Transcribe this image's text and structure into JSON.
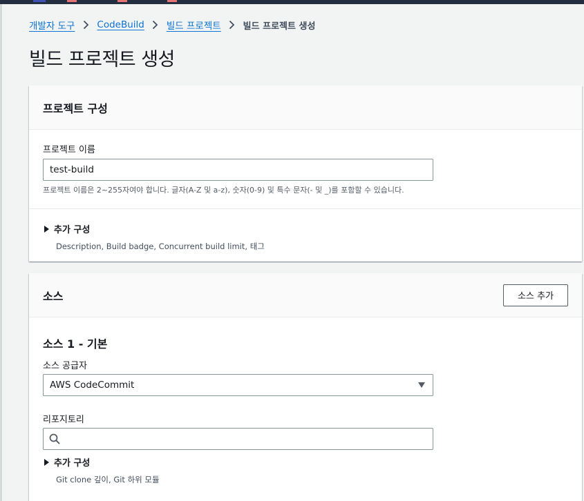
{
  "breadcrumb": {
    "items": [
      "개발자 도구",
      "CodeBuild",
      "빌드 프로젝트"
    ],
    "current": "빌드 프로젝트 생성"
  },
  "page": {
    "title": "빌드 프로젝트 생성"
  },
  "project_config": {
    "heading": "프로젝트 구성",
    "name_label": "프로젝트 이름",
    "name_value": "test-build",
    "name_hint": "프로젝트 이름은 2~255자여야 합니다. 글자(A-Z 및 a-z), 숫자(0-9) 및 특수 문자(- 및 _)를 포함할 수 있습니다.",
    "additional": {
      "title": "추가 구성",
      "desc": "Description, Build badge, Concurrent build limit, 태그"
    }
  },
  "source": {
    "heading": "소스",
    "add_button": "소스 추가",
    "source1_title": "소스 1 - 기본",
    "provider_label": "소스 공급자",
    "provider_value": "AWS CodeCommit",
    "repo_label": "리포지토리",
    "repo_value": "",
    "additional": {
      "title": "추가 구성",
      "desc": "Git clone 깊이, Git 하위 모듈"
    }
  },
  "colors": {
    "link": "#0972d3",
    "header_bar": "#232f3e",
    "page_bg": "#f2f3f3",
    "input_border": "#879596"
  }
}
